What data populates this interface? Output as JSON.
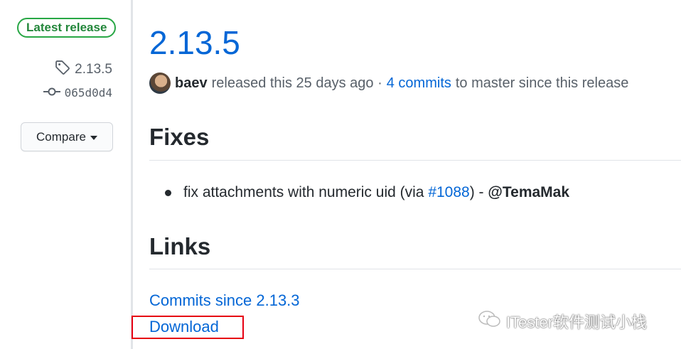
{
  "sidebar": {
    "badge": "Latest release",
    "tag": "2.13.5",
    "commit": "065d0d4",
    "compare_label": "Compare"
  },
  "release": {
    "title": "2.13.5",
    "author": "baev",
    "released_text": "released this 25 days ago ·",
    "commits_link": "4 commits",
    "since_text": "to master since this release"
  },
  "sections": {
    "fixes_heading": "Fixes",
    "fix_item": {
      "text": "fix attachments with numeric uid (via",
      "pr_link": "#1088",
      "after": ") -",
      "mention": "@TemaMak"
    },
    "links_heading": "Links",
    "commits_since_link": "Commits since 2.13.3",
    "download_link": "Download"
  },
  "watermark": "ITester软件测试小栈",
  "colors": {
    "link": "#0366d6",
    "badge": "#28a745",
    "highlight": "#e60012"
  },
  "icons": [
    "tag-icon",
    "git-commit-icon",
    "caret-down-icon",
    "wechat-icon"
  ]
}
